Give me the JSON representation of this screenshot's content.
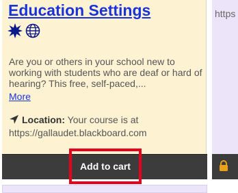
{
  "course_card": {
    "title": "Education Settings",
    "format_icons": [
      "starburst-icon",
      "globe-icon"
    ],
    "description": "Are you or others in your school new to working with students who are deaf or hard of hearing? This free, self-paced,...",
    "more_label": "More",
    "location_label": "Location:",
    "location_text": "Your course is at",
    "location_url": "https://gallaudet.blackboard.com",
    "add_to_cart_label": "Add to cart"
  },
  "right_card": {
    "text_fragment": "https"
  },
  "colors": {
    "card_background": "#fdf3d3",
    "link": "#1a33d8",
    "cart_bar": "#3c3c3c",
    "highlight_border": "#e8001c",
    "right_card_background": "#ece4f8",
    "lock_icon": "#e8a21a"
  }
}
